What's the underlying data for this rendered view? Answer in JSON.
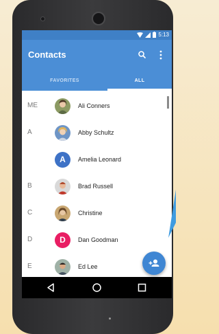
{
  "status_bar": {
    "time": "5:13",
    "icons": [
      "wifi-icon",
      "signal-icon",
      "battery-icon"
    ]
  },
  "app_bar": {
    "title": "Contacts",
    "icons": [
      "search-icon",
      "more-vert-icon"
    ]
  },
  "tabs": [
    {
      "label": "FAVORITES",
      "selected": false
    },
    {
      "label": "ALL",
      "selected": true
    }
  ],
  "contacts": [
    {
      "letter": "ME",
      "name": "Ali Conners",
      "avatar": "photo",
      "color": "#7a8a55"
    },
    {
      "letter": "A",
      "name": "Abby Schultz",
      "avatar": "photo",
      "color": "#5b83b8"
    },
    {
      "letter": "",
      "name": "Amelia Leonard",
      "avatar": "A",
      "color": "#3e72c6"
    },
    {
      "letter": "B",
      "name": "Brad Russell",
      "avatar": "photo",
      "color": "#c46c4a"
    },
    {
      "letter": "C",
      "name": "Christine",
      "avatar": "photo",
      "color": "#a07a4a"
    },
    {
      "letter": "D",
      "name": "Dan Goodman",
      "avatar": "D",
      "color": "#e91e63"
    },
    {
      "letter": "E",
      "name": "Ed Lee",
      "avatar": "photo",
      "color": "#6d7d6a"
    }
  ],
  "fab": {
    "icon": "add-person-icon",
    "color": "#3f86d3"
  },
  "nav_bar": {
    "icons": [
      "back-icon",
      "home-icon",
      "recents-icon"
    ]
  },
  "colors": {
    "primary": "#4b8ed6",
    "status_bar": "#3f80c6",
    "accent": "#3f86d3"
  }
}
